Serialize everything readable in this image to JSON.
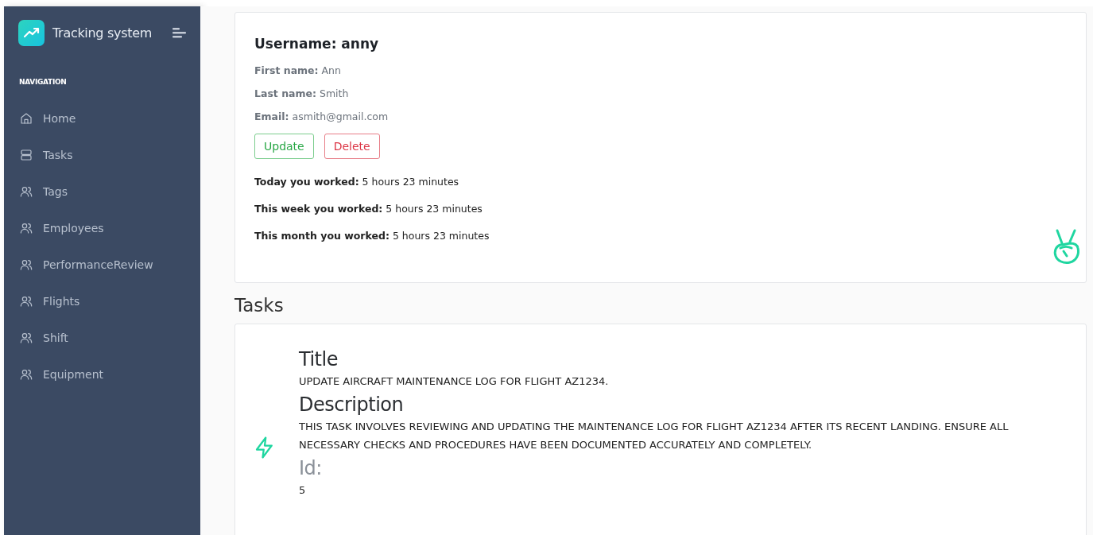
{
  "sidebar": {
    "brand": "Tracking system",
    "section": "NAVIGATION",
    "items": [
      {
        "label": "Home",
        "kind": "home"
      },
      {
        "label": "Tasks",
        "kind": "tasks"
      },
      {
        "label": "Tags",
        "kind": "people"
      },
      {
        "label": "Employees",
        "kind": "people"
      },
      {
        "label": "PerformanceReview",
        "kind": "people"
      },
      {
        "label": "Flights",
        "kind": "people"
      },
      {
        "label": "Shift",
        "kind": "people"
      },
      {
        "label": "Equipment",
        "kind": "people"
      }
    ]
  },
  "profile": {
    "username": "Username: anny",
    "details": [
      "**First name:** Ann",
      "**Last name:** Smith",
      "**Email:** asmith@gmail.com"
    ],
    "buttons": [
      {
        "label": "Update",
        "kind": "success"
      },
      {
        "label": "Delete",
        "kind": "danger"
      }
    ],
    "stats": [
      "**Today you worked:** 5 hours 23 minutes",
      "**This week you worked:** 5 hours 23 minutes",
      "**This month you worked:** 5 hours 23 minutes"
    ]
  },
  "tasks": {
    "heading": "Tasks",
    "fields": [
      {
        "label": "Title",
        "value": "UPDATE AIRCRAFT MAINTENANCE LOG FOR FLIGHT AZ1234.",
        "muted": false
      },
      {
        "label": "Description",
        "value": "THIS TASK INVOLVES REVIEWING AND UPDATING THE MAINTENANCE LOG FOR FLIGHT AZ1234 AFTER ITS RECENT LANDING. ENSURE ALL NECESSARY CHECKS AND PROCEDURES HAVE BEEN DOCUMENTED ACCURATELY AND COMPLETELY.",
        "muted": false
      },
      {
        "label": "Id:",
        "value": "5",
        "muted": true
      }
    ]
  }
}
